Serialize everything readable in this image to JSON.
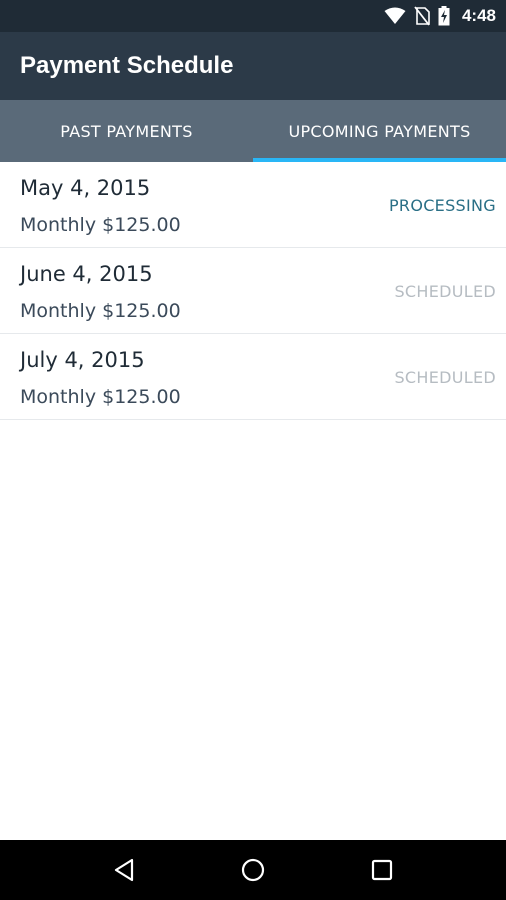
{
  "status_bar": {
    "time": "4:48",
    "icons": [
      "wifi-icon",
      "no-sim-icon",
      "battery-charging-icon"
    ]
  },
  "app_bar": {
    "title": "Payment Schedule"
  },
  "tabs": [
    {
      "label": "PAST PAYMENTS",
      "active": false
    },
    {
      "label": "UPCOMING PAYMENTS",
      "active": true
    }
  ],
  "payments": [
    {
      "date": "May 4, 2015",
      "amount": "Monthly $125.00",
      "status": "PROCESSING",
      "status_color": "#2a6f86"
    },
    {
      "date": "June 4, 2015",
      "amount": "Monthly $125.00",
      "status": "SCHEDULED",
      "status_color": "#b6bcc2"
    },
    {
      "date": "July 4, 2015",
      "amount": "Monthly $125.00",
      "status": "SCHEDULED",
      "status_color": "#b6bcc2"
    }
  ],
  "nav_bar": {
    "buttons": [
      "back-icon",
      "home-icon",
      "recents-icon"
    ]
  },
  "colors": {
    "status_bar_bg": "#1f2b36",
    "app_bar_bg": "#2c3a48",
    "tab_bar_bg": "#5a6a79",
    "tab_indicator": "#29b6f6"
  }
}
